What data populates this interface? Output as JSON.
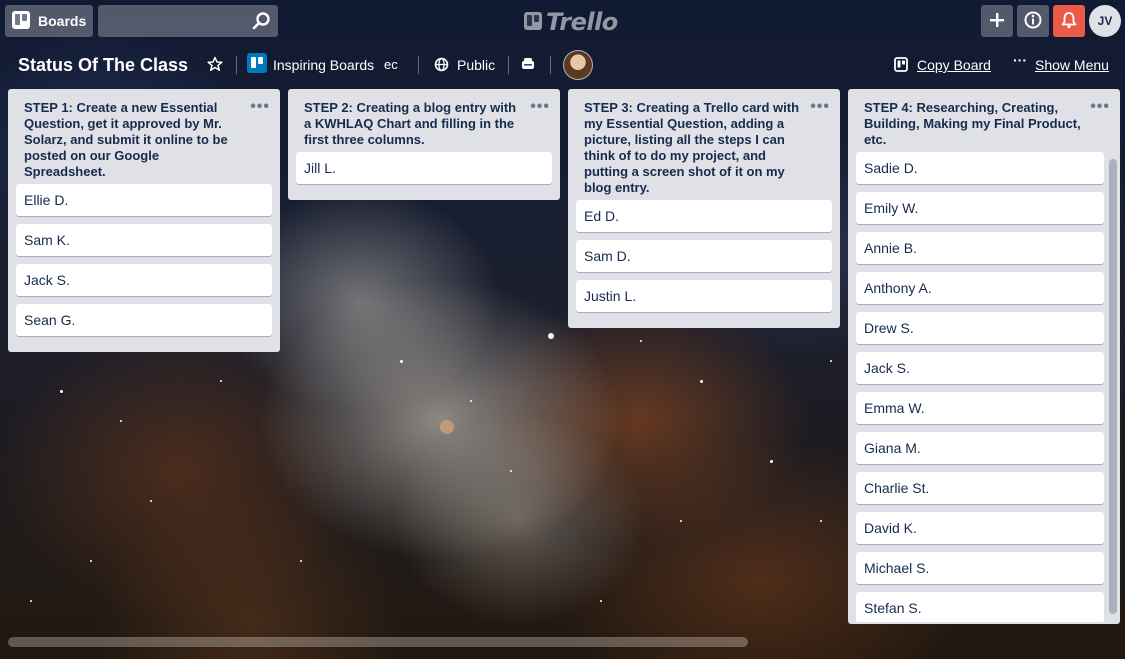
{
  "header": {
    "boards_label": "Boards",
    "search_placeholder": "",
    "logo_text": "Trello",
    "avatar_initials": "JV"
  },
  "board": {
    "title": "Status Of The Class",
    "team_name": "Inspiring Boards",
    "team_tag": "ec",
    "visibility": "Public",
    "copy_board_label": "Copy Board",
    "show_menu_label": "Show Menu"
  },
  "lists": [
    {
      "title": "STEP 1: Create a new Essential Question, get it approved by Mr. Solarz, and submit it online to be posted on our Google Spreadsheet.",
      "menu": "•••",
      "cards": [
        "Ellie D.",
        "Sam K.",
        "Jack S.",
        "Sean G."
      ]
    },
    {
      "title": "STEP 2: Creating a blog entry with a KWHLAQ Chart and filling in the first three columns.",
      "menu": "•••",
      "cards": [
        "Jill L."
      ]
    },
    {
      "title": "STEP 3: Creating a Trello card with my Essential Question, adding a picture, listing all the steps I can think of to do my project, and putting a screen shot of it on my blog entry.",
      "menu": "•••",
      "cards": [
        "Ed D.",
        "Sam D.",
        "Justin L."
      ]
    },
    {
      "title": "STEP 4: Researching, Creating, Building, Making my Final Product, etc.",
      "menu": "•••",
      "cards": [
        "Sadie D.",
        "Emily W.",
        "Annie B.",
        "Anthony A.",
        "Drew S.",
        "Jack S.",
        "Emma W.",
        "Giana M.",
        "Charlie St.",
        "David K.",
        "Michael S.",
        "Stefan S."
      ]
    }
  ],
  "icons": {
    "boards": "boards-icon",
    "search": "search-icon",
    "plus": "plus-icon",
    "info": "info-icon",
    "bell": "bell-icon",
    "star": "star-icon",
    "globe": "globe-icon",
    "butler": "butler-icon",
    "copy": "copy-board-icon",
    "menu": "more-icon"
  },
  "colors": {
    "notification": "#eb5a46",
    "team_badge": "#0079bf",
    "list_bg": "#dfe1e6"
  }
}
